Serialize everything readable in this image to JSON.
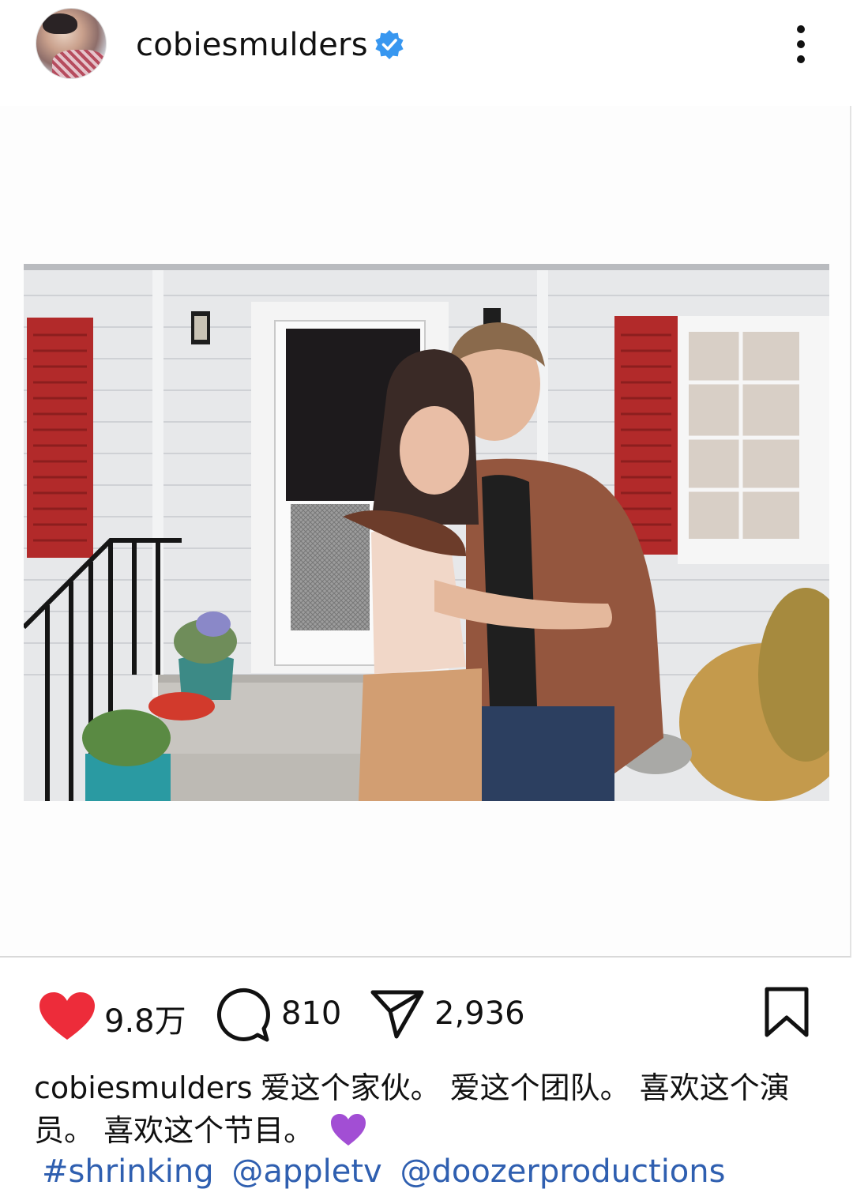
{
  "post": {
    "username": "cobiesmulders",
    "verified": true,
    "avatar_icon": "profile-avatar",
    "more_icon": "more-vertical-icon"
  },
  "actions": {
    "likes": "9.8万",
    "comments": "810",
    "shares": "2,936",
    "like_color": "#ed2c3a",
    "icons": [
      "heart-icon",
      "comment-icon",
      "share-icon",
      "bookmark-icon"
    ]
  },
  "caption": {
    "username": "cobiesmulders",
    "text": "爱这个家伙。 爱这个团队。 喜欢这个演员。 喜欢这个节目。",
    "emoji": "purple-heart",
    "tags": [
      "#shrinking",
      "@appletv",
      "@doozerproductions"
    ],
    "link_color": "#2f5fb0"
  }
}
